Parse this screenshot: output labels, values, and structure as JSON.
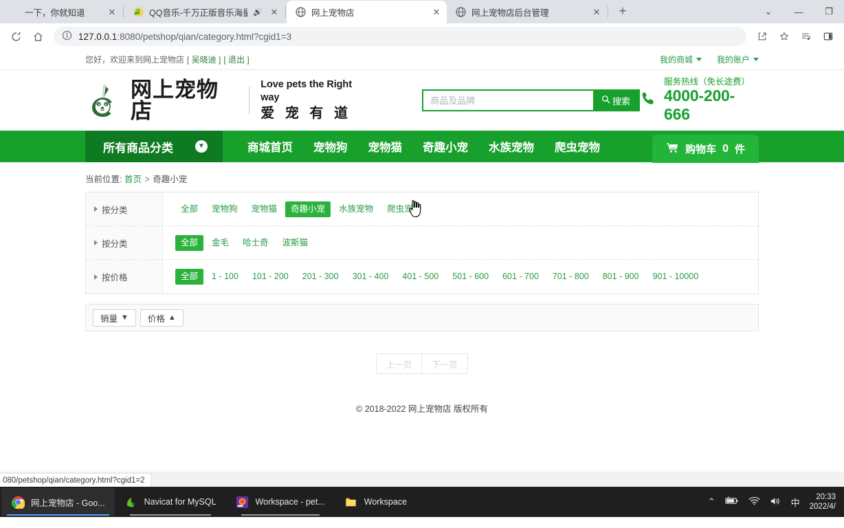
{
  "browser": {
    "tabs": [
      {
        "title": "一下，你就知道",
        "favicon": "",
        "active": false,
        "audio": false
      },
      {
        "title": "QQ音乐-千万正版音乐海量",
        "favicon": "music-note-icon",
        "active": false,
        "audio": true
      },
      {
        "title": "网上宠物店",
        "favicon": "globe-icon",
        "active": true,
        "audio": false
      },
      {
        "title": "网上宠物店后台管理",
        "favicon": "globe-icon",
        "active": false,
        "audio": false
      }
    ],
    "new_tab_label": "+",
    "window_controls": {
      "list": "⌄",
      "minimize": "—",
      "maximize": "❐"
    },
    "toolbar": {
      "reload_icon": "reload-icon",
      "home_icon": "home-icon",
      "info_icon": "info-circle-icon",
      "url_host": "127.0.0.1",
      "url_port": ":8080",
      "url_path": "/petshop/qian/category.html?cgid1=3",
      "share_icon": "share-icon",
      "bookmark_icon": "star-icon",
      "playlist_icon": "media-list-icon",
      "sidepanel_icon": "side-panel-icon"
    }
  },
  "site": {
    "topbar": {
      "greeting": "您好，欢迎来到网上宠物店",
      "username": "[ 吴晓迪 ]",
      "logout": "[ 退出 ]",
      "my_mall": "我的商城",
      "my_account": "我的账户"
    },
    "header": {
      "logo_text": "网上宠物店",
      "slogan_en": "Love pets the Right way",
      "slogan_cn": "爱 宠 有 道",
      "search_placeholder": "商品及品牌",
      "search_value": "",
      "search_button": "搜索",
      "search_icon": "search-icon",
      "hotline_label": "服务热线（免长途费）",
      "hotline_number": "4000-200-666",
      "phone_icon": "phone-icon"
    },
    "nav": {
      "all_categories": "所有商品分类",
      "chevron_icon": "chevron-down-circle-icon",
      "links": [
        "商城首页",
        "宠物狗",
        "宠物猫",
        "奇趣小宠",
        "水族宠物",
        "爬虫宠物"
      ],
      "cart_icon": "shopping-cart-icon",
      "cart_label": "购物车",
      "cart_count": "0",
      "cart_unit": "件"
    },
    "breadcrumb": {
      "prefix": "当前位置:",
      "home": "首页",
      "separator": ">",
      "current": "奇趣小宠"
    },
    "filters": [
      {
        "label": "按分类",
        "values": [
          "全部",
          "宠物狗",
          "宠物猫",
          "奇趣小宠",
          "水族宠物",
          "爬虫宠物"
        ],
        "selected": 3
      },
      {
        "label": "按分类",
        "values": [
          "全部",
          "金毛",
          "哈士奇",
          "波斯猫"
        ],
        "selected": 0
      },
      {
        "label": "按价格",
        "values": [
          "全部",
          "1 - 100",
          "101 - 200",
          "201 - 300",
          "301 - 400",
          "401 - 500",
          "501 - 600",
          "601 - 700",
          "701 - 800",
          "801 - 900",
          "901 - 10000"
        ],
        "selected": 0
      }
    ],
    "sort": [
      {
        "label": "销量",
        "arrow": "▼",
        "dir": "desc"
      },
      {
        "label": "价格",
        "arrow": "▲",
        "dir": "asc"
      }
    ],
    "pagination": {
      "prev": "上一页",
      "next": "下一页",
      "disabled": true
    },
    "footer": "© 2018-2022 网上宠物店 版权所有"
  },
  "statusbar": {
    "url": "080/petshop/qian/category.html?cgid1=2"
  },
  "taskbar": {
    "items": [
      {
        "label": "网上宠物店 - Goo...",
        "icon": "chrome-icon",
        "active": true
      },
      {
        "label": "Navicat for MySQL",
        "icon": "navicat-icon",
        "active": false
      },
      {
        "label": "Workspace - pet...",
        "icon": "intellij-icon",
        "active": false
      },
      {
        "label": "Workspace",
        "icon": "folder-icon",
        "active": false
      }
    ],
    "tray": {
      "chevron": "⌃",
      "battery_icon": "battery-icon",
      "wifi_icon": "wifi-icon",
      "volume_icon": "volume-icon",
      "ime": "中",
      "time": "20:33",
      "date": "2022/4/"
    }
  },
  "colors": {
    "brand_green": "#18a02d",
    "dark_green": "#0e7a22",
    "cart_green": "#23b539",
    "link_green": "#2a9b45",
    "select_green": "#2ab23c"
  }
}
